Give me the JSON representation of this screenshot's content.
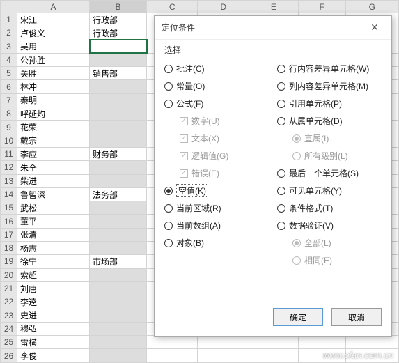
{
  "columns": [
    "A",
    "B",
    "C",
    "D",
    "E",
    "F",
    "G"
  ],
  "rows": [
    {
      "n": 1,
      "a": "宋江",
      "b": "行政部",
      "sel": false
    },
    {
      "n": 2,
      "a": "卢俊义",
      "b": "行政部",
      "sel": false
    },
    {
      "n": 3,
      "a": "吴用",
      "b": "",
      "sel": true,
      "active": true
    },
    {
      "n": 4,
      "a": "公孙胜",
      "b": "",
      "sel": true
    },
    {
      "n": 5,
      "a": "关胜",
      "b": "销售部",
      "sel": false
    },
    {
      "n": 6,
      "a": "林冲",
      "b": "",
      "sel": true
    },
    {
      "n": 7,
      "a": "秦明",
      "b": "",
      "sel": true
    },
    {
      "n": 8,
      "a": "呼延灼",
      "b": "",
      "sel": true
    },
    {
      "n": 9,
      "a": "花荣",
      "b": "",
      "sel": true
    },
    {
      "n": 10,
      "a": "戴宗",
      "b": "",
      "sel": true
    },
    {
      "n": 11,
      "a": "李应",
      "b": "财务部",
      "sel": false
    },
    {
      "n": 12,
      "a": "朱仝",
      "b": "",
      "sel": true
    },
    {
      "n": 13,
      "a": "柴进",
      "b": "",
      "sel": true
    },
    {
      "n": 14,
      "a": "鲁智深",
      "b": "法务部",
      "sel": false
    },
    {
      "n": 15,
      "a": "武松",
      "b": "",
      "sel": true
    },
    {
      "n": 16,
      "a": "董平",
      "b": "",
      "sel": true
    },
    {
      "n": 17,
      "a": "张清",
      "b": "",
      "sel": true
    },
    {
      "n": 18,
      "a": "杨志",
      "b": "",
      "sel": true
    },
    {
      "n": 19,
      "a": "徐宁",
      "b": "市场部",
      "sel": false
    },
    {
      "n": 20,
      "a": "索超",
      "b": "",
      "sel": true
    },
    {
      "n": 21,
      "a": "刘唐",
      "b": "",
      "sel": true
    },
    {
      "n": 22,
      "a": "李逵",
      "b": "",
      "sel": true
    },
    {
      "n": 23,
      "a": "史进",
      "b": "",
      "sel": true
    },
    {
      "n": 24,
      "a": "穆弘",
      "b": "",
      "sel": true
    },
    {
      "n": 25,
      "a": "雷横",
      "b": "",
      "sel": true
    },
    {
      "n": 26,
      "a": "李俊",
      "b": "",
      "sel": true
    }
  ],
  "dialog": {
    "title": "定位条件",
    "section": "选择",
    "left": [
      {
        "type": "radio",
        "label": "批注(C)",
        "checked": false
      },
      {
        "type": "radio",
        "label": "常量(O)",
        "checked": false
      },
      {
        "type": "radio",
        "label": "公式(F)",
        "checked": false
      },
      {
        "type": "chk",
        "label": "数字(U)",
        "indent": true,
        "checked": true,
        "disabled": true
      },
      {
        "type": "chk",
        "label": "文本(X)",
        "indent": true,
        "checked": true,
        "disabled": true
      },
      {
        "type": "chk",
        "label": "逻辑值(G)",
        "indent": true,
        "checked": true,
        "disabled": true
      },
      {
        "type": "chk",
        "label": "错误(E)",
        "indent": true,
        "checked": true,
        "disabled": true
      },
      {
        "type": "radio",
        "label": "空值(K)",
        "checked": true,
        "box": true
      },
      {
        "type": "radio",
        "label": "当前区域(R)",
        "checked": false
      },
      {
        "type": "radio",
        "label": "当前数组(A)",
        "checked": false
      },
      {
        "type": "radio",
        "label": "对象(B)",
        "checked": false
      }
    ],
    "right": [
      {
        "type": "radio",
        "label": "行内容差异单元格(W)",
        "checked": false
      },
      {
        "type": "radio",
        "label": "列内容差异单元格(M)",
        "checked": false
      },
      {
        "type": "radio",
        "label": "引用单元格(P)",
        "checked": false
      },
      {
        "type": "radio",
        "label": "从属单元格(D)",
        "checked": false
      },
      {
        "type": "radio",
        "label": "直属(I)",
        "indent": true,
        "checked": true,
        "disabled": true
      },
      {
        "type": "radio",
        "label": "所有级别(L)",
        "indent": true,
        "checked": false,
        "disabled": true
      },
      {
        "type": "radio",
        "label": "最后一个单元格(S)",
        "checked": false
      },
      {
        "type": "radio",
        "label": "可见单元格(Y)",
        "checked": false
      },
      {
        "type": "radio",
        "label": "条件格式(T)",
        "checked": false
      },
      {
        "type": "radio",
        "label": "数据验证(V)",
        "checked": false
      },
      {
        "type": "radio",
        "label": "全部(L)",
        "indent": true,
        "checked": true,
        "disabled": true
      },
      {
        "type": "radio",
        "label": "相同(E)",
        "indent": true,
        "checked": false,
        "disabled": true
      }
    ],
    "ok": "确定",
    "cancel": "取消"
  },
  "watermark": "www.cfan.com.cn"
}
